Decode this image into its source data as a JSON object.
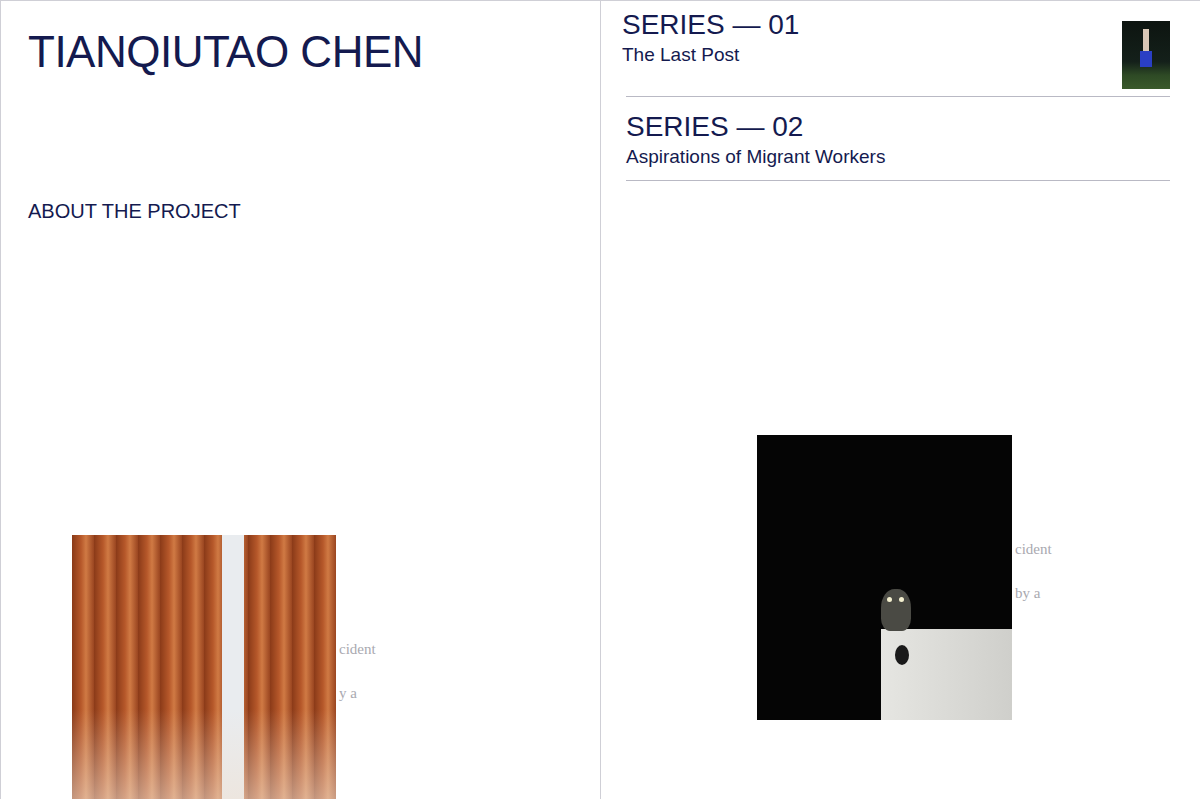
{
  "header": {
    "name": "TIANQIUTAO CHEN",
    "about": "ABOUT THE PROJECT"
  },
  "series": [
    {
      "number": "SERIES — 01",
      "title": "The Last Post",
      "selected": true
    },
    {
      "number": "SERIES — 02",
      "title": "Aspirations of Migrant Workers",
      "selected": false
    }
  ],
  "previews": [
    {
      "fragments": [
        "cident",
        "y a"
      ]
    },
    {
      "fragments": [
        "cident",
        "by a"
      ]
    }
  ]
}
